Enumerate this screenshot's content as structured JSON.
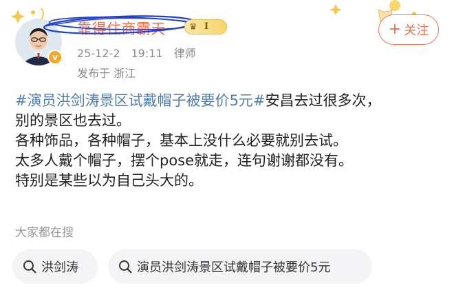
{
  "user": {
    "name": "靠得住商霸天",
    "vip_label": "I",
    "follow_label": "关注",
    "follow_plus": "+"
  },
  "meta": {
    "date": "25-12-2",
    "time": "19:11",
    "role": "律师",
    "location": "发布于 浙江"
  },
  "post": {
    "topic": "#演员洪剑涛景区试戴帽子被要价5元#",
    "line1_rest": "安昌去过很多次，",
    "line2": "别的景区也去过。",
    "line3": "各种饰品，各种帽子，基本上没什么必要就别去试。",
    "line4": "太多人戴个帽子，摆个pose就走，连句谢谢都没有。",
    "line5": "特别是某些以为自己头大的。"
  },
  "search": {
    "hint": "大家都在搜",
    "chips": [
      {
        "label": "洪剑涛",
        "icon": "search-icon"
      },
      {
        "label": "演员洪剑涛景区试戴帽子被要价5元",
        "icon": "search-icon"
      }
    ]
  },
  "colors": {
    "accent": "#eb7350",
    "topic": "#507daf",
    "scribble": "#1f3fd1"
  }
}
